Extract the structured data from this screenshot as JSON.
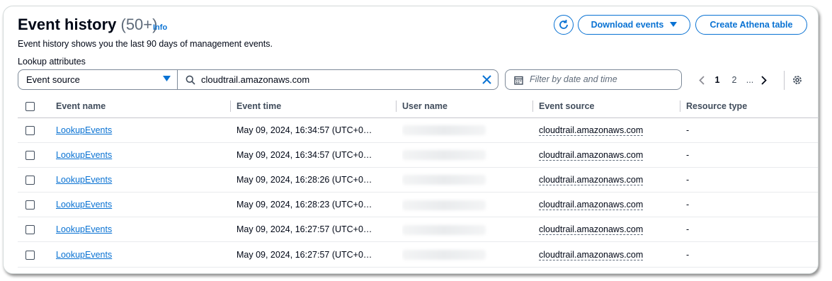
{
  "header": {
    "title": "Event history",
    "count": "(50+)",
    "info": "Info",
    "description": "Event history shows you the last 90 days of management events.",
    "refresh_icon": "refresh-icon",
    "download_label": "Download events",
    "athena_label": "Create Athena table"
  },
  "filters": {
    "lookup_label": "Lookup attributes",
    "attribute": "Event source",
    "search_value": "cloudtrail.amazonaws.com",
    "date_placeholder": "Filter by date and time"
  },
  "pagination": {
    "pages": [
      "1",
      "2"
    ],
    "current": "1",
    "ellipsis": "..."
  },
  "colors": {
    "accent": "#0972d3",
    "text": "#000716",
    "border": "#7d8998"
  },
  "table": {
    "columns": [
      "Event name",
      "Event time",
      "User name",
      "Event source",
      "Resource type"
    ],
    "rows": [
      {
        "event_name": "LookupEvents",
        "event_time": "May 09, 2024, 16:34:57 (UTC+0…",
        "event_source": "cloudtrail.amazonaws.com",
        "resource_type": "-"
      },
      {
        "event_name": "LookupEvents",
        "event_time": "May 09, 2024, 16:34:57 (UTC+0…",
        "event_source": "cloudtrail.amazonaws.com",
        "resource_type": "-"
      },
      {
        "event_name": "LookupEvents",
        "event_time": "May 09, 2024, 16:28:26 (UTC+0…",
        "event_source": "cloudtrail.amazonaws.com",
        "resource_type": "-"
      },
      {
        "event_name": "LookupEvents",
        "event_time": "May 09, 2024, 16:28:23 (UTC+0…",
        "event_source": "cloudtrail.amazonaws.com",
        "resource_type": "-"
      },
      {
        "event_name": "LookupEvents",
        "event_time": "May 09, 2024, 16:27:57 (UTC+0…",
        "event_source": "cloudtrail.amazonaws.com",
        "resource_type": "-"
      },
      {
        "event_name": "LookupEvents",
        "event_time": "May 09, 2024, 16:27:57 (UTC+0…",
        "event_source": "cloudtrail.amazonaws.com",
        "resource_type": "-"
      }
    ]
  }
}
